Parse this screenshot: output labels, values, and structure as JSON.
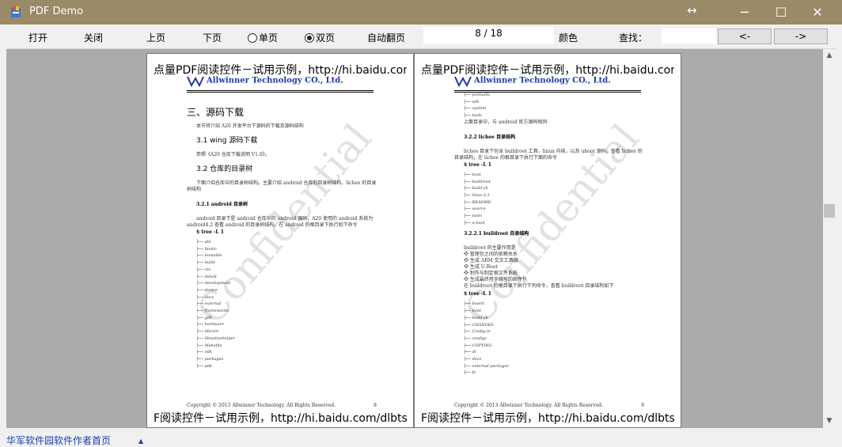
{
  "window": {
    "title": "PDF Demo",
    "resize_glyph": "↔",
    "minimize_glyph": "─",
    "maximize_glyph": "☐",
    "close_glyph": "✕"
  },
  "toolbar": {
    "open": "打开",
    "close": "关闭",
    "prev": "上页",
    "next": "下页",
    "single": "单页",
    "double": "双页",
    "view_mode_selected": "double",
    "autoflip": "自动翻页",
    "page_indicator": "8 / 18",
    "color": "颜色",
    "find": "查找：",
    "search_value": "",
    "find_prev": "<-",
    "find_next": "->"
  },
  "trial_banner_top": "点量PDF阅读控件－试用示例，http://hi.baidu.com/dlbtsoft",
  "trial_banner_bottom": "F阅读控件－试用示例，http://hi.baidu.com/dlbtsoft",
  "watermark": "Confidential",
  "logo_text": "Allwinner Technology CO., Ltd.",
  "left_page": {
    "title": "三、源码下载",
    "intro": "本节将介绍 A20 开发平台下源码的下载及源码结构",
    "s1": "3.1 wing 源码下载",
    "s1_text": "参照《A20 仓库下载说明 V1.0》。",
    "s2": "3.2 仓库的目录树",
    "s2_text": "下面介绍仓库中的目录树结构。主要介绍 android 仓库的目录树结构、lichee 的目录树结构",
    "s3": "3.2.1 android 目录树",
    "s3_text": "android 目录下是 android 仓库中的 android 源码，A20 使用的 android 系统为 android4.2 查看 android 的目录树结构，在 android 的根目录下执行如下命令",
    "cmd": "$ tree -L 1",
    "tree": [
      "abi",
      "bionic",
      "bootable",
      "build",
      "cts",
      "dalvik",
      "development",
      "device",
      "docs",
      "external",
      "frameworks",
      "gdk",
      "hardware",
      "libcore",
      "libnativehelper",
      "Makefile",
      "ndk",
      "packages",
      "pdk"
    ],
    "footer": "Copyright © 2013 Allwinner Technology. All Rights Reserved.",
    "page_no": "8"
  },
  "right_page": {
    "tree_top": [
      "prebuilts",
      "sdk",
      "system",
      "tools"
    ],
    "after_tree": "上面目录中，与 android 官方源码相同",
    "s1": "3.2.2 lichee 目录结构",
    "s1_text": "lichee 目录下包含 buildroot 工具，linux 内核，以及 uboot 源码。查看 lichee 的目录结构，在 lichee 的根目录下执行下面的命令",
    "cmd": "$ tree -L 1",
    "tree_mid": [
      "boot",
      "buildroot",
      "build.sh",
      "linux-3.3",
      "README",
      "source",
      "tools",
      "u-boot"
    ],
    "s2": "3.2.2.1 buildroot 目录结构",
    "s2_intro": "buildroot 的主要作用是",
    "bullets": [
      "管理包之间的依赖关系",
      "生成 ARM 交叉工具链",
      "生成 U-Boot",
      "制作与制定根文件系统",
      "生成最终用于烧写的固件包"
    ],
    "s2_tail": "在 buildroot 的根目录下执行下列命令，查看 buildroot 目录结构如下",
    "cmd2": "$ tree -L 1",
    "tree_bot": [
      "board",
      "boot",
      "build.sh",
      "CHANGES",
      "Config.in",
      "configs",
      "COPYING",
      "dl",
      "docs",
      "external-packages",
      "fs"
    ],
    "footer": "Copyright © 2013 Allwinner Technology. All Rights Reserved.",
    "page_no": "9"
  },
  "taskbar_text": "华军软件园软件作者首页"
}
